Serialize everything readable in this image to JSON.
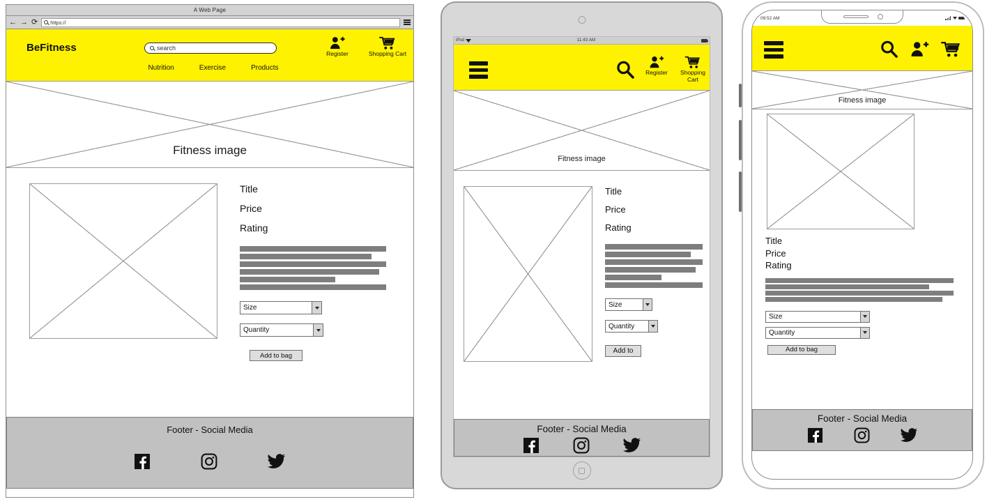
{
  "meta": {
    "kind": "responsive-wireframe-mockup",
    "brand_yellow": "#fff200",
    "footer_gray": "#c1c1c1",
    "bar_gray": "#7e7e7e",
    "line_gray": "#9a9a9a"
  },
  "desktop": {
    "browser": {
      "window_title": "A Web Page",
      "back_icon": "←",
      "forward_icon": "→",
      "reload_icon": "⟳",
      "url_value": "https://",
      "search_icon": "search-icon",
      "menu_icon": "hamburger-menu-icon"
    },
    "header": {
      "logo": "BeFitness",
      "search_placeholder": "search",
      "register_label": "Register",
      "cart_label": "Shopping Cart",
      "register_icon": "user-add-icon",
      "cart_icon": "shopping-cart-icon",
      "nav": [
        "Nutrition",
        "Exercise",
        "Products"
      ]
    },
    "hero": {
      "label": "Fitness image"
    },
    "product": {
      "image_label": "",
      "title": "Title",
      "price": "Price",
      "rating": "Rating",
      "description_bars": [
        100,
        90,
        100,
        95,
        65,
        100
      ],
      "size_label": "Size",
      "quantity_label": "Quantity",
      "add_button": "Add to bag"
    },
    "footer": {
      "title": "Footer - Social Media",
      "social": [
        "facebook-icon",
        "instagram-icon",
        "twitter-icon"
      ]
    }
  },
  "tablet": {
    "status": {
      "carrier": "iPod",
      "wifi_icon": "wifi-icon",
      "time": "11:43 AM",
      "battery_icon": "battery-icon"
    },
    "header": {
      "menu_icon": "hamburger-menu-icon",
      "search_icon": "search-icon",
      "register_label": "Register",
      "cart_label": "Shopping Cart",
      "register_icon": "user-add-icon",
      "cart_icon": "shopping-cart-icon"
    },
    "hero": {
      "label": "Fitness image"
    },
    "product": {
      "title": "Title",
      "price": "Price",
      "rating": "Rating",
      "description_bars": [
        100,
        88,
        100,
        93,
        58,
        100
      ],
      "size_label": "Size",
      "quantity_label": "Quantity",
      "add_button": "Add to"
    },
    "footer": {
      "title": "Footer - Social Media",
      "social": [
        "facebook-icon",
        "instagram-icon",
        "twitter-icon"
      ]
    },
    "home_button_icon": "home-button-icon"
  },
  "phone": {
    "status": {
      "time": "09:52 AM",
      "signal_icon": "signal-icon",
      "wifi_icon": "wifi-icon",
      "battery_icon": "battery-icon"
    },
    "header": {
      "menu_icon": "hamburger-menu-icon",
      "search_icon": "search-icon",
      "register_icon": "user-add-icon",
      "cart_icon": "shopping-cart-icon"
    },
    "hero": {
      "label": "Fitness image"
    },
    "product": {
      "title": "Title",
      "price": "Price",
      "rating": "Rating",
      "description_bars": [
        100,
        87,
        100,
        94
      ],
      "size_label": "Size",
      "quantity_label": "Quantity",
      "add_button": "Add to bag"
    },
    "footer": {
      "title": "Footer - Social Media",
      "social": [
        "facebook-icon",
        "instagram-icon",
        "twitter-icon"
      ]
    }
  }
}
